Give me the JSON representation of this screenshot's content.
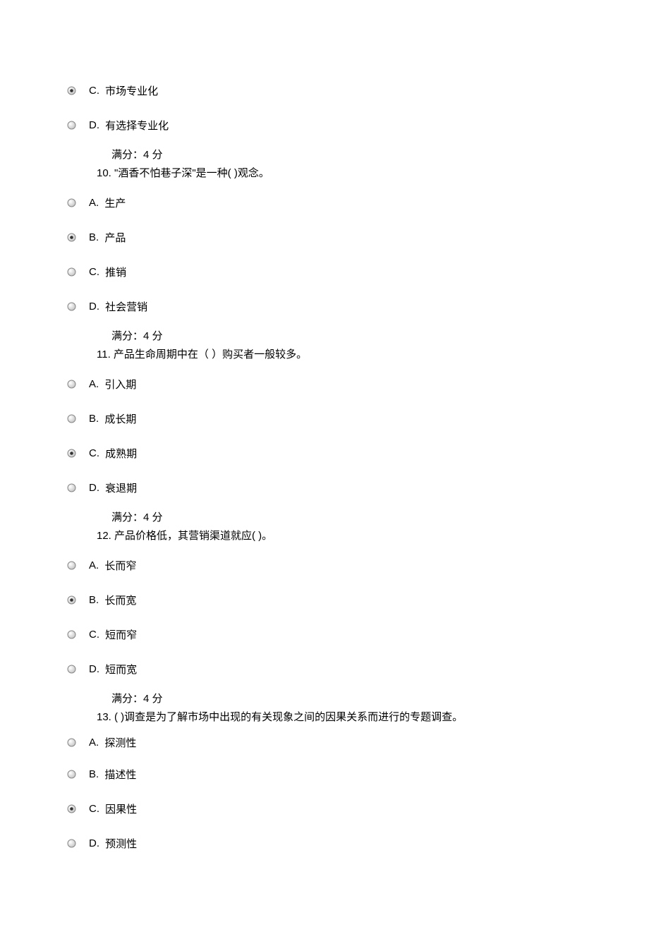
{
  "icons": {
    "selected": "radio-selected-icon",
    "unselected": "radio-unselected-icon"
  },
  "q9_tail": {
    "options": [
      {
        "letter": "C.",
        "text": " 市场专业化",
        "selected": true
      },
      {
        "letter": "D.",
        "text": " 有选择专业化",
        "selected": false
      }
    ]
  },
  "score_label": "满分：4  分",
  "q10": {
    "question": "10.  \"酒香不怕巷子深\"是一种(       )观念。",
    "options": [
      {
        "letter": "A.",
        "text": " 生产",
        "selected": false
      },
      {
        "letter": "B.",
        "text": " 产品",
        "selected": true
      },
      {
        "letter": "C.",
        "text": " 推销",
        "selected": false
      },
      {
        "letter": "D.",
        "text": " 社会营销",
        "selected": false
      }
    ]
  },
  "q11": {
    "question": "11.  产品生命周期中在（  ）购买者一般较多。",
    "options": [
      {
        "letter": "A.",
        "text": " 引入期",
        "selected": false
      },
      {
        "letter": "B.",
        "text": " 成长期",
        "selected": false
      },
      {
        "letter": "C.",
        "text": " 成熟期",
        "selected": true
      },
      {
        "letter": "D.",
        "text": " 衰退期",
        "selected": false
      }
    ]
  },
  "q12": {
    "question": "12.  产品价格低，其营销渠道就应(       )。",
    "options": [
      {
        "letter": "A.",
        "text": " 长而窄",
        "selected": false
      },
      {
        "letter": "B.",
        "text": " 长而宽",
        "selected": true
      },
      {
        "letter": "C.",
        "text": " 短而窄",
        "selected": false
      },
      {
        "letter": "D.",
        "text": " 短而宽",
        "selected": false
      }
    ]
  },
  "q13": {
    "question": "13.  (       )调查是为了解市场中出现的有关现象之间的因果关系而进行的专题调查。",
    "options": [
      {
        "letter": "A.",
        "text": " 探测性",
        "selected": false
      },
      {
        "letter": "B.",
        "text": " 描述性",
        "selected": false
      },
      {
        "letter": "C.",
        "text": " 因果性",
        "selected": true
      },
      {
        "letter": "D.",
        "text": " 预测性",
        "selected": false
      }
    ]
  }
}
